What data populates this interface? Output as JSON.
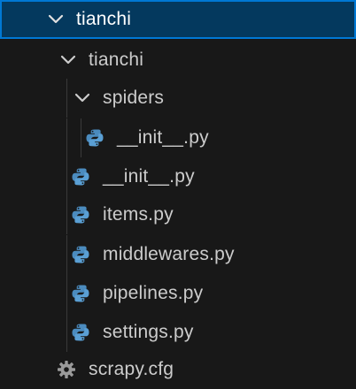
{
  "explorer": {
    "items": [
      {
        "label": "tianchi",
        "type": "folder",
        "expanded": true,
        "selected": true
      },
      {
        "label": "tianchi",
        "type": "folder",
        "expanded": true
      },
      {
        "label": "spiders",
        "type": "folder",
        "expanded": true
      },
      {
        "label": "__init__.py",
        "type": "python-file"
      },
      {
        "label": "__init__.py",
        "type": "python-file"
      },
      {
        "label": "items.py",
        "type": "python-file"
      },
      {
        "label": "middlewares.py",
        "type": "python-file"
      },
      {
        "label": "pipelines.py",
        "type": "python-file"
      },
      {
        "label": "settings.py",
        "type": "python-file"
      },
      {
        "label": "scrapy.cfg",
        "type": "config-file"
      }
    ]
  },
  "colors": {
    "background": "#181818",
    "selection_bg": "#04395e",
    "selection_border": "#0078d4",
    "text": "#cccccc",
    "python_blue": "#4b8bbe",
    "python_yellow": "#ffd43b",
    "gear": "#9a9a9a"
  },
  "icons": {
    "folder_chevron": "chevron-down-icon",
    "python": "python-icon",
    "config": "gear-icon"
  }
}
